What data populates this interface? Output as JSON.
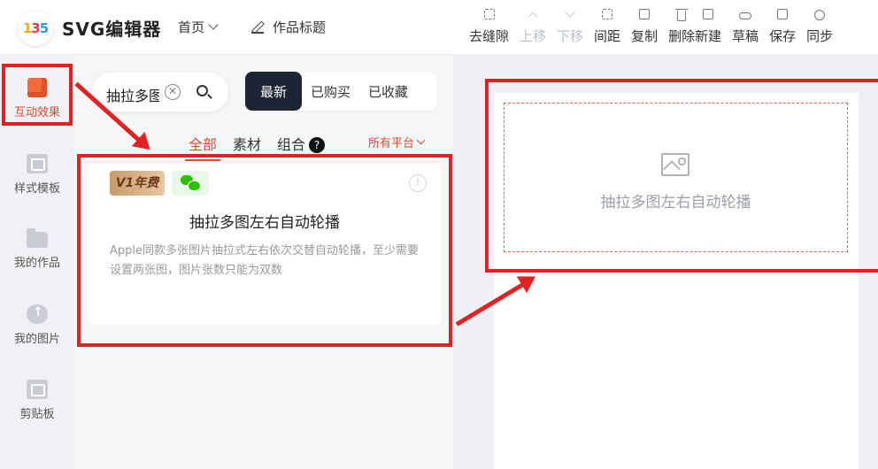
{
  "header": {
    "app_name": "SVG编辑器",
    "nav_home": "首页",
    "work_title": "作品标题",
    "toolbar": [
      {
        "label": "去缝隙",
        "icon": "grid-icon",
        "enabled": true
      },
      {
        "label": "上移",
        "icon": "move-up-icon",
        "enabled": false
      },
      {
        "label": "下移",
        "icon": "move-down-icon",
        "enabled": false
      },
      {
        "label": "间距",
        "icon": "spacing-icon",
        "enabled": true
      },
      {
        "label": "复制",
        "icon": "copy-icon",
        "enabled": true
      },
      {
        "label": "删除",
        "icon": "trash-icon",
        "enabled": true
      },
      {
        "label": "新建",
        "icon": "new-file-icon",
        "enabled": true
      },
      {
        "label": "草稿",
        "icon": "cloud-icon",
        "enabled": true
      },
      {
        "label": "保存",
        "icon": "save-icon",
        "enabled": true
      },
      {
        "label": "同步",
        "icon": "sync-icon",
        "enabled": true
      }
    ]
  },
  "sidebar": {
    "items": [
      {
        "label": "互动效果",
        "icon": "cube-icon",
        "active": true
      },
      {
        "label": "样式模板",
        "icon": "template-icon",
        "active": false
      },
      {
        "label": "我的作品",
        "icon": "folder-icon",
        "active": false
      },
      {
        "label": "我的图片",
        "icon": "cloud-upload-icon",
        "active": false
      },
      {
        "label": "剪贴板",
        "icon": "clipboard-icon",
        "active": false
      }
    ]
  },
  "panel": {
    "search_value": "抽拉多图左右自动轮播",
    "sort": [
      "最新",
      "已购买",
      "已收藏"
    ],
    "tabs": [
      "全部",
      "素材",
      "组合"
    ],
    "platform": "所有平台",
    "card": {
      "badge_vip": "V1年费",
      "title": "抽拉多图左右自动轮播",
      "description": "Apple同款多张图片抽拉式左右依次交替自动轮播，至少需要设置两张图，图片张数只能为双数"
    }
  },
  "canvas": {
    "placeholder_label": "抽拉多图左右自动轮播"
  },
  "colors": {
    "accent": "#e8472b",
    "annotation": "#e02222",
    "dark_button": "#1d2433"
  }
}
